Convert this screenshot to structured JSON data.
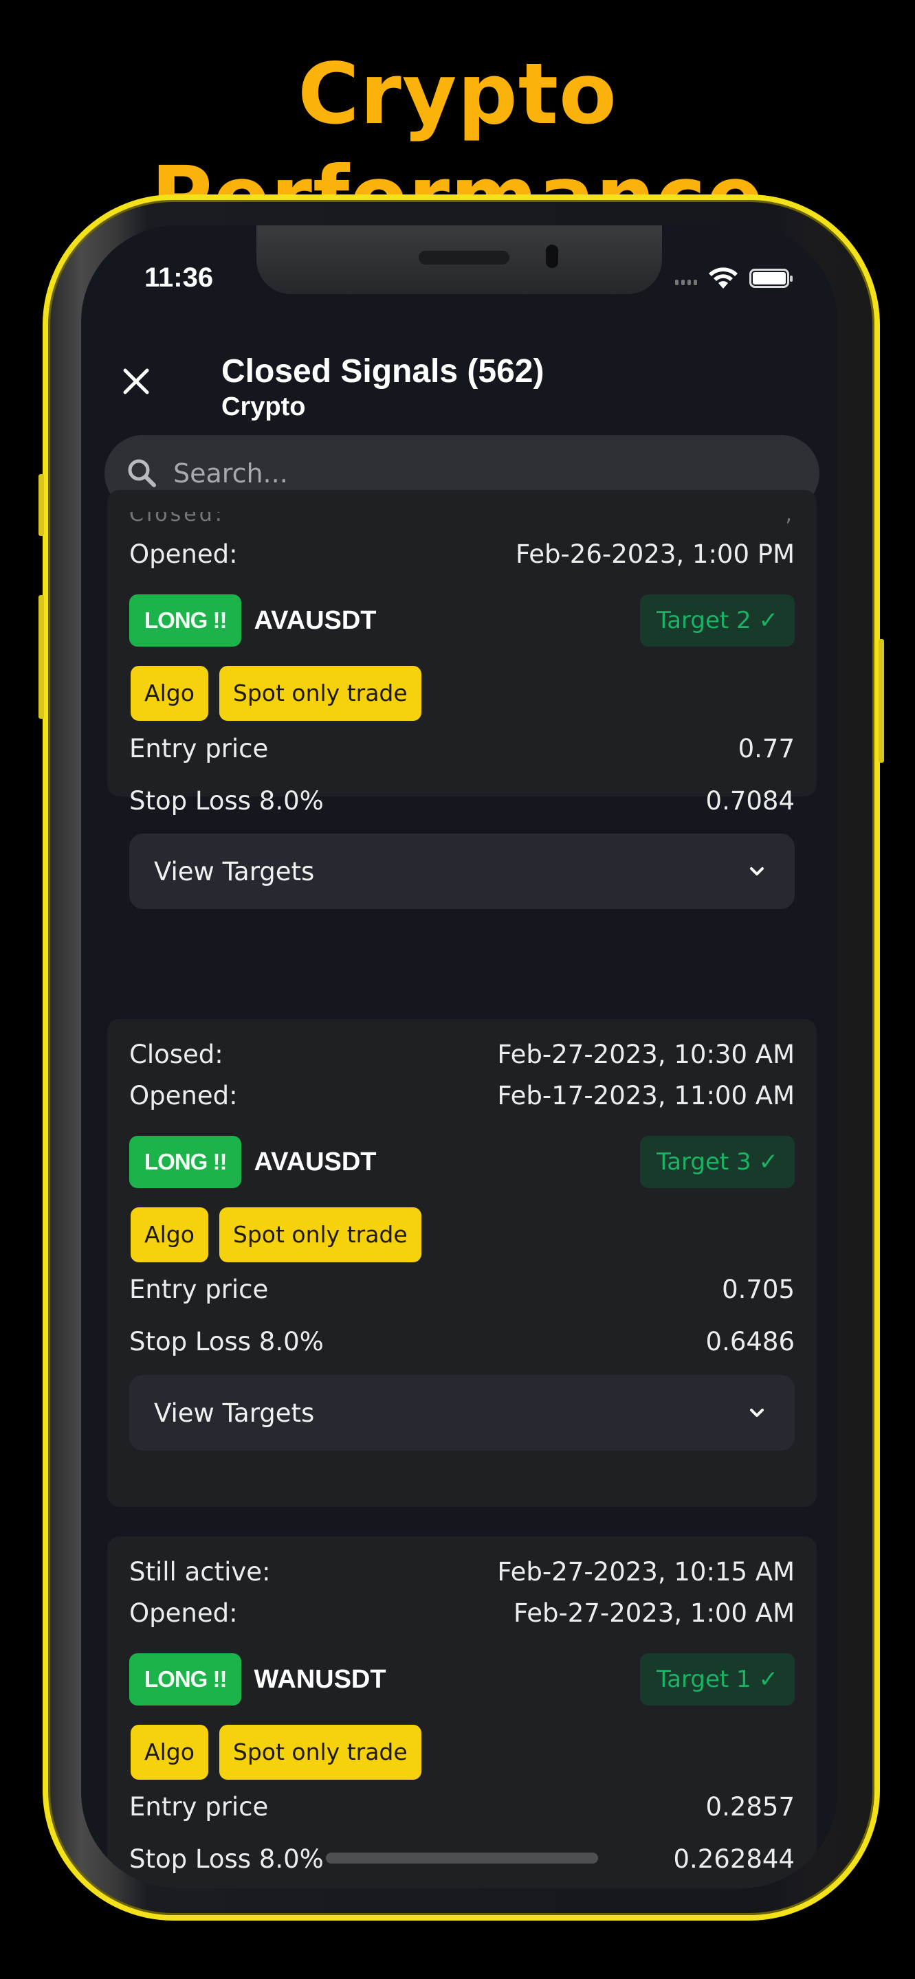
{
  "promo": {
    "title": "Crypto Performance",
    "accent": "#fbb20a",
    "frame_color": "#f3e21a"
  },
  "status_bar": {
    "time": "11:36",
    "wifi_icon": "wifi-icon",
    "battery_icon": "battery-icon",
    "signal_icon": "cellular-signal-icon"
  },
  "header": {
    "close_icon": "close-icon",
    "title": "Closed Signals (562)",
    "subtitle": "Crypto"
  },
  "search": {
    "placeholder": "Search...",
    "value": "",
    "icon": "search-icon"
  },
  "partial_card_top": {
    "label_fragment": "Closed:",
    "value_fragment": ","
  },
  "signals": [
    {
      "rows_top": [
        {
          "label": "Opened:",
          "value": "Feb-26-2023, 1:00 PM"
        }
      ],
      "direction": "LONG !!",
      "symbol": "AVAUSDT",
      "target": "Target 2 ✓",
      "tags": [
        "Algo",
        "Spot only trade"
      ],
      "entry_label": "Entry price",
      "entry_value": "0.77",
      "stop_label": "Stop Loss 8.0%",
      "stop_value": "0.7084",
      "view_targets": "View Targets"
    },
    {
      "rows_top": [
        {
          "label": "Closed:",
          "value": "Feb-27-2023, 10:30 AM"
        },
        {
          "label": "Opened:",
          "value": "Feb-17-2023, 11:00 AM"
        }
      ],
      "direction": "LONG !!",
      "symbol": "AVAUSDT",
      "target": "Target 3 ✓",
      "tags": [
        "Algo",
        "Spot only trade"
      ],
      "entry_label": "Entry price",
      "entry_value": "0.705",
      "stop_label": "Stop Loss 8.0%",
      "stop_value": "0.6486",
      "view_targets": "View Targets"
    },
    {
      "rows_top": [
        {
          "label": "Still active:",
          "value": "Feb-27-2023, 10:15 AM"
        },
        {
          "label": "Opened:",
          "value": "Feb-27-2023, 1:00 AM"
        }
      ],
      "direction": "LONG !!",
      "symbol": "WANUSDT",
      "target": "Target 1 ✓",
      "tags": [
        "Algo",
        "Spot only trade"
      ],
      "entry_label": "Entry price",
      "entry_value": "0.2857",
      "stop_label": "Stop Loss 8.0%",
      "stop_value": "0.262844"
    }
  ],
  "colors": {
    "long_badge": "#1bb34a",
    "target_badge_bg": "#173a2a",
    "target_badge_text": "#1ab264",
    "tag_bg": "#f6d20c",
    "card_bg": "#1e2024",
    "screen_bg": "#15171e"
  }
}
